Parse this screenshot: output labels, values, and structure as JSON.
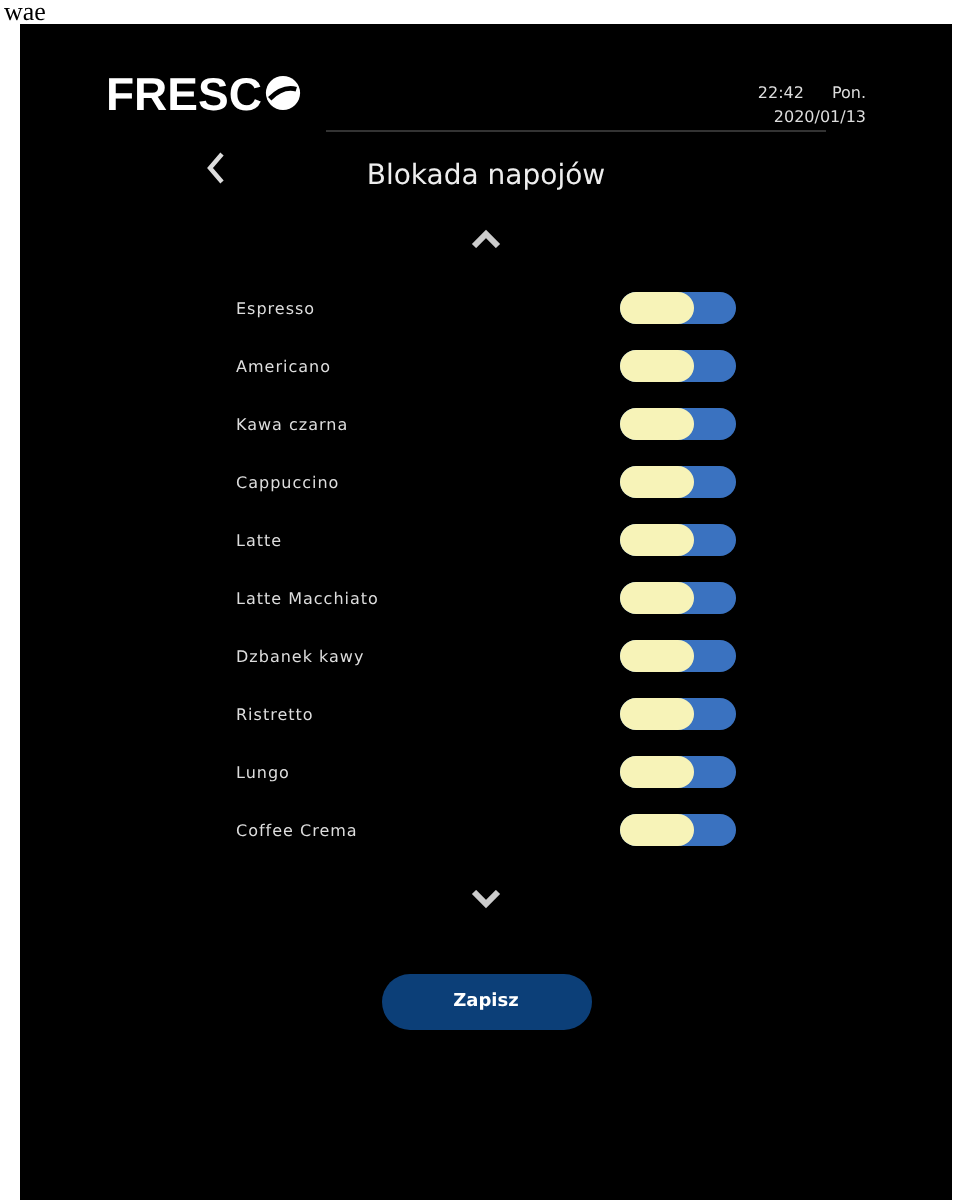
{
  "caption": "wae",
  "header": {
    "logo": "FRESC",
    "time": "22:42",
    "day": "Pon.",
    "date": "2020/01/13"
  },
  "title": "Blokada napojów",
  "drinks": [
    {
      "name": "Espresso",
      "on": true
    },
    {
      "name": "Americano",
      "on": true
    },
    {
      "name": "Kawa czarna",
      "on": true
    },
    {
      "name": "Cappuccino",
      "on": true
    },
    {
      "name": "Latte",
      "on": true
    },
    {
      "name": "Latte Macchiato",
      "on": true
    },
    {
      "name": "Dzbanek kawy",
      "on": true
    },
    {
      "name": "Ristretto",
      "on": true
    },
    {
      "name": "Lungo",
      "on": true
    },
    {
      "name": "Coffee Crema",
      "on": true
    }
  ],
  "save_button": "Zapisz"
}
